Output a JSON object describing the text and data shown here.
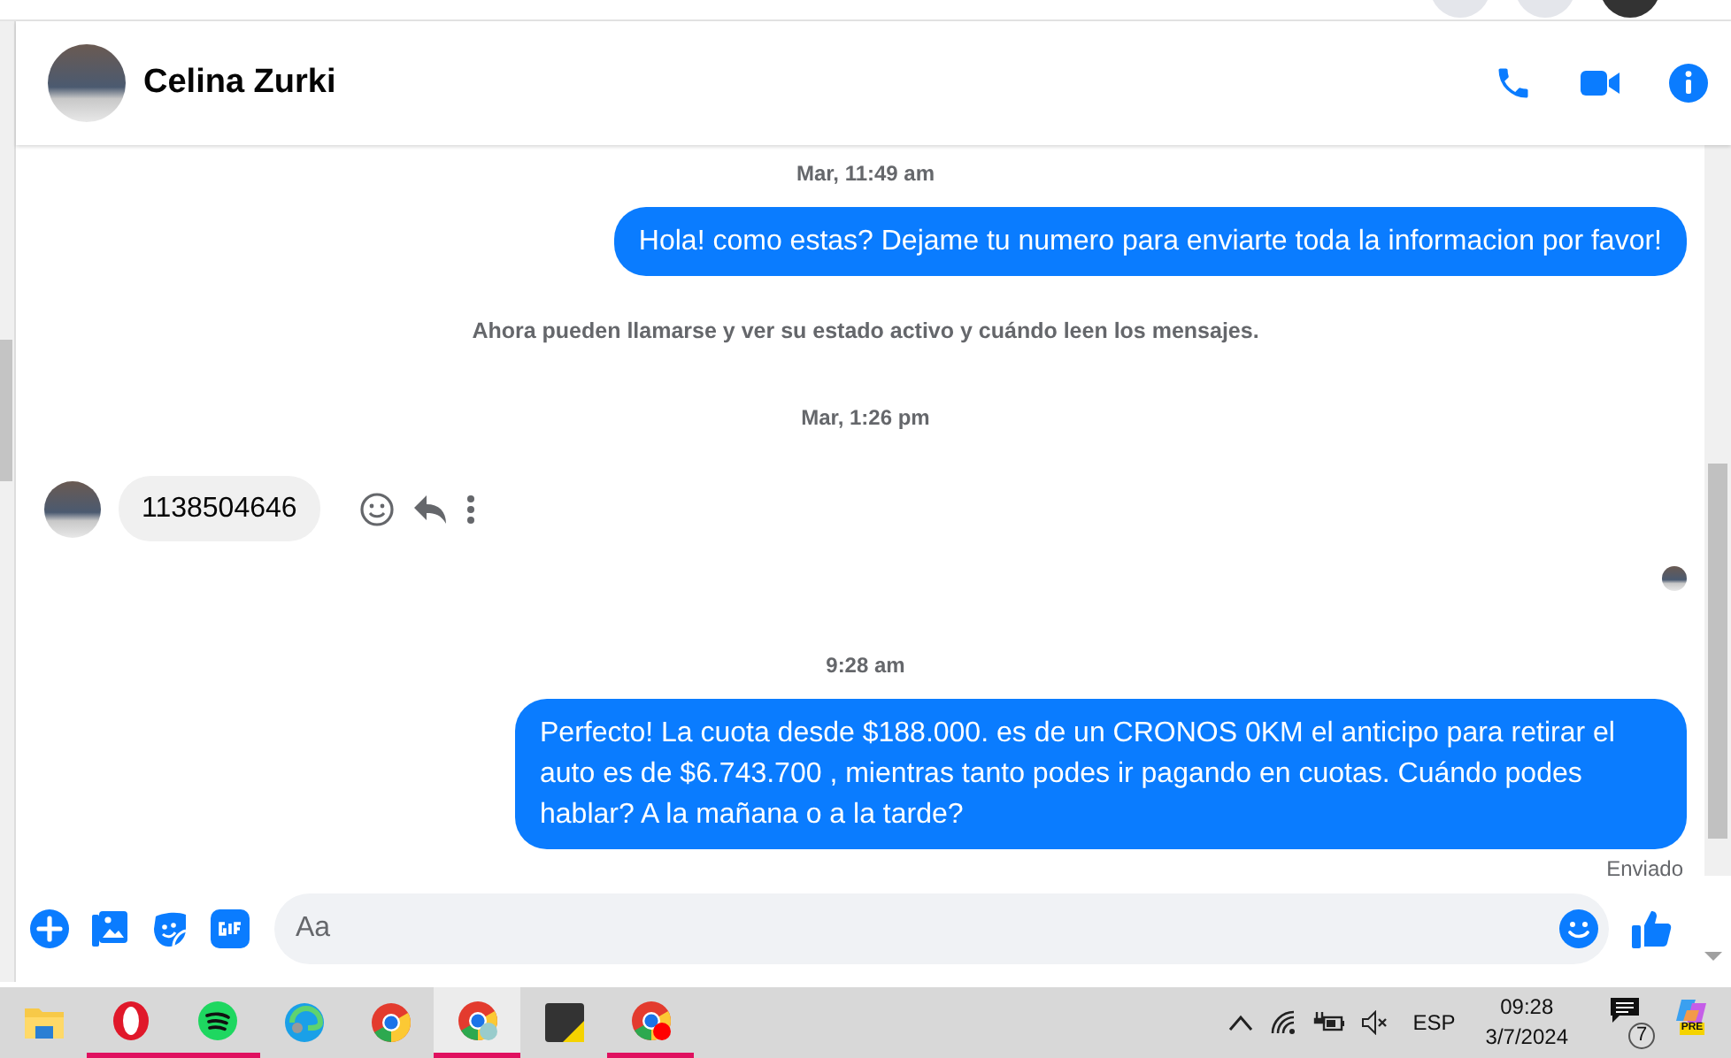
{
  "conversation": {
    "title": "Celina Zurki"
  },
  "messages": [
    {
      "kind": "timestamp",
      "text": "Mar, 11:49 am"
    },
    {
      "kind": "outgoing",
      "text": "Hola! como estas? Dejame tu numero para enviarte toda la informacion por favor!"
    },
    {
      "kind": "notice",
      "text": "Ahora pueden llamarse y ver su estado activo y cuándo leen los mensajes."
    },
    {
      "kind": "timestamp",
      "text": "Mar, 1:26 pm"
    },
    {
      "kind": "incoming",
      "text": "1138504646"
    },
    {
      "kind": "seen"
    },
    {
      "kind": "timestamp",
      "text": "9:28 am"
    },
    {
      "kind": "outgoing",
      "text": "Perfecto! La cuota desde $188.000. es de un CRONOS 0KM el anticipo para retirar el auto es de $6.743.700 , mientras tanto podes ir pagando en cuotas. Cuándo podes hablar? A la mañana o a la tarde?"
    },
    {
      "kind": "status",
      "text": "Enviado"
    }
  ],
  "composer": {
    "placeholder": "Aa"
  },
  "taskbar": {
    "apps": [
      {
        "kind": "folder",
        "running": false,
        "selected": false
      },
      {
        "kind": "opera",
        "running": true,
        "selected": false
      },
      {
        "kind": "spotify",
        "running": true,
        "selected": false
      },
      {
        "kind": "edge",
        "running": false,
        "selected": false
      },
      {
        "kind": "chrome",
        "running": false,
        "selected": false
      },
      {
        "kind": "chrome-profile",
        "running": true,
        "selected": true
      },
      {
        "kind": "notes",
        "running": false,
        "selected": false
      },
      {
        "kind": "chrome-red",
        "running": true,
        "selected": false
      }
    ],
    "language": "ESP",
    "time": "09:28",
    "date": "3/7/2024",
    "notification_count": "7",
    "copilot_badge": "PRE"
  }
}
